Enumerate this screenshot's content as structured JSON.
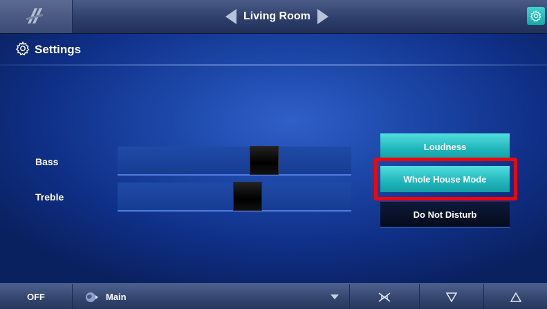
{
  "header": {
    "room_title": "Living Room"
  },
  "page": {
    "title": "Settings"
  },
  "sliders": [
    {
      "label": "Bass",
      "level_percent": 64
    },
    {
      "label": "Treble",
      "level_percent": 56
    }
  ],
  "buttons": [
    {
      "label": "Loudness",
      "state": "on"
    },
    {
      "label": "Whole House Mode",
      "state": "on"
    },
    {
      "label": "Do Not Disturb",
      "state": "off"
    }
  ],
  "footer": {
    "off_label": "OFF",
    "source_label": "Main"
  },
  "colors": {
    "accent_active": "#1fb6bb",
    "highlight": "#ff0000",
    "background": "#1c47a8"
  },
  "icons": [
    "logo-icon",
    "arrow-left-icon",
    "arrow-right-icon",
    "gear-icon",
    "source-globe-icon",
    "chevron-down-icon",
    "mute-icon",
    "volume-down-icon",
    "volume-up-icon"
  ]
}
